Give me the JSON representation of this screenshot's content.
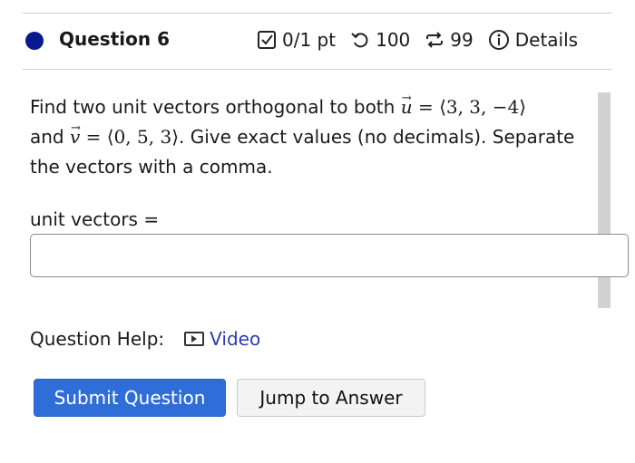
{
  "question": {
    "title": "Question 6",
    "score": "0/1 pt",
    "retries": "100",
    "attempts": "99",
    "details_label": "Details"
  },
  "prompt": {
    "part1": "Find two unit vectors orthogonal to both ",
    "u_name": "u",
    "u_value": "⟨3, 3, −4⟩",
    "and": "and ",
    "v_name": "v",
    "v_value": "⟨0, 5, 3⟩",
    "part2": ". Give exact values (no decimals). Separate the vectors with a comma."
  },
  "answer": {
    "label": "unit vectors =",
    "value": ""
  },
  "help": {
    "label": "Question Help:",
    "video_label": "Video"
  },
  "buttons": {
    "submit": "Submit Question",
    "jump": "Jump to Answer"
  },
  "colors": {
    "status_dot": "#0a1a8c",
    "primary": "#2f6ed8",
    "link": "#2d3bb0"
  }
}
